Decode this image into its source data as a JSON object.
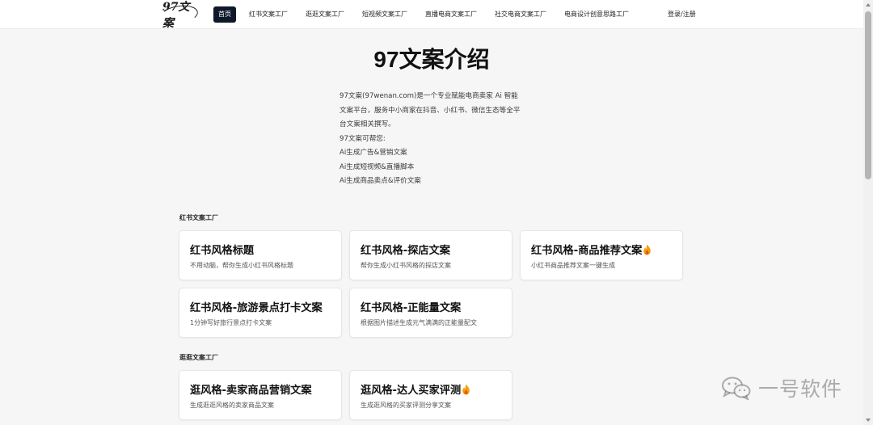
{
  "nav": {
    "logo_text": "97文案",
    "items": [
      {
        "label": "首页",
        "active": true
      },
      {
        "label": "红书文案工厂"
      },
      {
        "label": "逛逛文案工厂"
      },
      {
        "label": "短视频文案工厂"
      },
      {
        "label": "直播电商文案工厂"
      },
      {
        "label": "社交电商文案工厂"
      },
      {
        "label": "电商设计创意思路工厂"
      }
    ],
    "login": "登录/注册"
  },
  "hero": {
    "title": "97文案介绍",
    "intro_lines": [
      "97文案(97wenan.com)是一个专业赋能电商卖家 Ai 智能",
      "文案平台，服务中小商家在抖音、小红书、微信生态等全平",
      "台文案相关撰写。",
      "97文案可帮您:",
      "Ai生成广告&营销文案",
      "Ai生成短视频&直播脚本",
      "Ai生成商品卖点&评价文案"
    ]
  },
  "sections": [
    {
      "title": "红书文案工厂",
      "cards": [
        {
          "title": "红书风格标题",
          "desc": "不用动脑，帮你生成小红书风格标题",
          "hot": false
        },
        {
          "title": "红书风格-探店文案",
          "desc": "帮你生成小红书风格的探店文案",
          "hot": false
        },
        {
          "title": "红书风格-商品推荐文案",
          "desc": "小红书商品推荐文案一键生成",
          "hot": true
        },
        {
          "title": "红书风格-旅游景点打卡文案",
          "desc": "1分钟写好旅行景点打卡文案",
          "hot": false
        },
        {
          "title": "红书风格-正能量文案",
          "desc": "根据图片描述生成元气满满的正能量配文",
          "hot": false
        }
      ]
    },
    {
      "title": "逛逛文案工厂",
      "cards": [
        {
          "title": "逛风格-卖家商品营销文案",
          "desc": "生成逛逛风格的卖家商品文案",
          "hot": false
        },
        {
          "title": "逛风格-达人买家评测",
          "desc": "生成逛风格的买家评测分享文案",
          "hot": true
        }
      ]
    }
  ],
  "watermark": {
    "text": "一号软件",
    "icon": "wechat-icon"
  },
  "icons": {
    "hot": "fire-icon"
  },
  "colors": {
    "active_nav_bg": "#0f172a",
    "fire": "#f59e0b"
  }
}
